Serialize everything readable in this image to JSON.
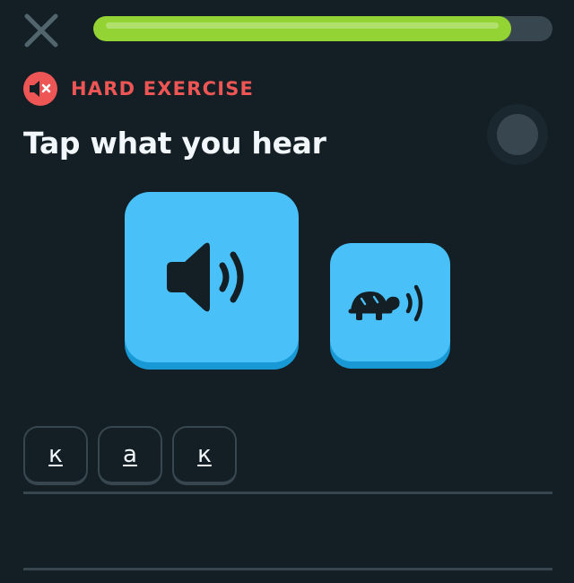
{
  "header": {
    "close_icon": "close-icon",
    "progress": {
      "value": 0.91,
      "fill_color": "#93d333",
      "track_color": "#37464f"
    }
  },
  "challenge": {
    "difficulty_label": "HARD EXERCISE",
    "difficulty_icon": "speaker-muted-icon",
    "difficulty_color": "#ee5555",
    "title": "Tap what you hear",
    "audio_button_icon": "speaker-icon",
    "slow_audio_button_icon": "turtle-speaker-icon",
    "button_color": "#49c0f8"
  },
  "answer": {
    "tiles": [
      {
        "text": "к"
      },
      {
        "text": "а"
      },
      {
        "text": "к"
      }
    ]
  }
}
